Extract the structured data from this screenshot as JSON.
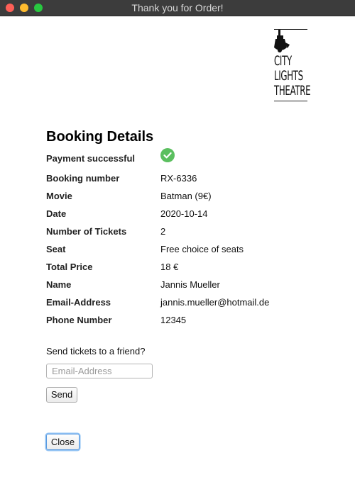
{
  "window": {
    "title": "Thank you for Order!"
  },
  "logo": {
    "lines": [
      "CITY",
      "LIGHTS",
      "THEATRE"
    ]
  },
  "booking": {
    "heading": "Booking Details",
    "payment_label": "Payment successful",
    "payment_icon": "check-circle-icon",
    "rows": [
      {
        "label": "Booking number",
        "value": "RX-6336"
      },
      {
        "label": "Movie",
        "value": "Batman (9€)"
      },
      {
        "label": "Date",
        "value": "2020-10-14"
      },
      {
        "label": "Number of Tickets",
        "value": "2"
      },
      {
        "label": "Seat",
        "value": "Free choice of seats"
      },
      {
        "label": "Total Price",
        "value": "18 €"
      },
      {
        "label": "Name",
        "value": "Jannis Mueller"
      },
      {
        "label": "Email-Address",
        "value": "jannis.mueller@hotmail.de"
      },
      {
        "label": "Phone Number",
        "value": "12345"
      }
    ]
  },
  "share": {
    "label": "Send tickets to a friend?",
    "email_value": "",
    "email_placeholder": "Email-Address",
    "send_label": "Send"
  },
  "footer": {
    "close_label": "Close"
  },
  "colors": {
    "titlebar": "#3c3c3c",
    "success": "#5bbf5f",
    "focus_ring": "#5a9be0"
  }
}
